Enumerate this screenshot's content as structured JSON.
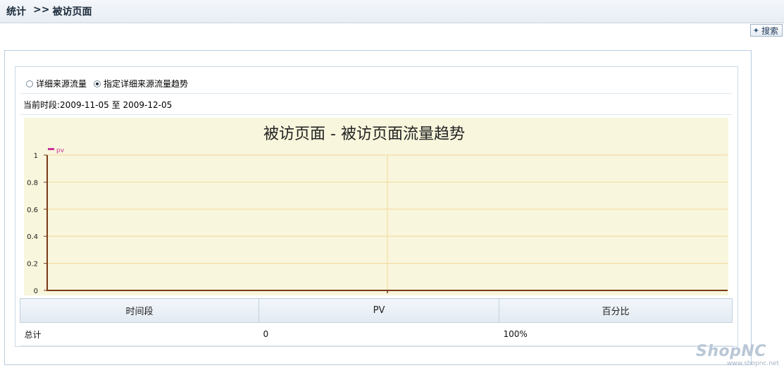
{
  "breadcrumb": {
    "root": "统计",
    "sep": ">>",
    "current": "被访页面"
  },
  "search_button": {
    "icon": "plus-icon",
    "label": "搜索"
  },
  "radios": [
    {
      "label": "详细来源流量",
      "checked": false
    },
    {
      "label": "指定详细来源流量趋势",
      "checked": true
    }
  ],
  "period": {
    "label": "当前时段:",
    "start": "2009-11-05",
    "to": "至",
    "end": "2009-12-05"
  },
  "chart_data": {
    "type": "line",
    "title": "被访页面 - 被访页面流量趋势",
    "series": [
      {
        "name": "pv",
        "values": [
          0,
          0,
          0
        ],
        "color": "#cc3399"
      }
    ],
    "x": [
      "",
      "",
      ""
    ],
    "yticks": [
      0,
      0.2,
      0.4,
      0.6,
      0.8,
      1
    ],
    "ylim": [
      0,
      1
    ],
    "grid": true,
    "background": "#f8f6dc",
    "gridline_color": "#f3d79b",
    "axis_color": "#7a3a1a",
    "legend_position": "top-left"
  },
  "table": {
    "headers": [
      "时间段",
      "PV",
      "百分比"
    ],
    "rows": [
      [
        "总计",
        "0",
        "100%"
      ]
    ]
  },
  "logo": {
    "brand": "ShopNC",
    "url": "www.shopnc.net"
  }
}
